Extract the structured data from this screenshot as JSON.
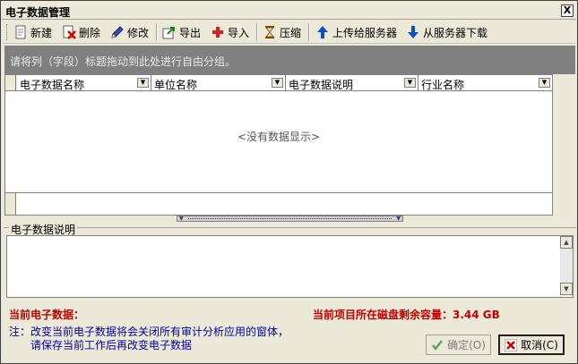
{
  "window": {
    "title": "电子数据管理",
    "close_label": "X"
  },
  "toolbar": {
    "new_label": "新建",
    "delete_label": "删除",
    "edit_label": "修改",
    "export_label": "导出",
    "import_label": "导入",
    "compress_label": "压缩",
    "upload_label": "上传给服务器",
    "download_label": "从服务器下载"
  },
  "group_panel": {
    "hint": "请将列（字段）标题拖动到此处进行自由分组。"
  },
  "grid": {
    "columns": [
      "电子数据名称",
      "单位名称",
      "电子数据说明",
      "行业名称"
    ],
    "empty_text": "<没有数据显示>"
  },
  "description": {
    "legend": "电子数据说明",
    "text": ""
  },
  "status": {
    "current_data_label": "当前电子数据：",
    "disk_label": "当前项目所在磁盘剩余容量：3.44 GB"
  },
  "note": {
    "line1": "注：改变当前电子数据将会关闭所有审计分析应用的窗体，",
    "line2": "请保存当前工作后再改变电子数据"
  },
  "buttons": {
    "ok_label": "确定(O)",
    "cancel_label": "取消(C)"
  },
  "colors": {
    "accent_red": "#c00000",
    "note_blue": "#0000a0",
    "group_panel_bg": "#808080"
  }
}
